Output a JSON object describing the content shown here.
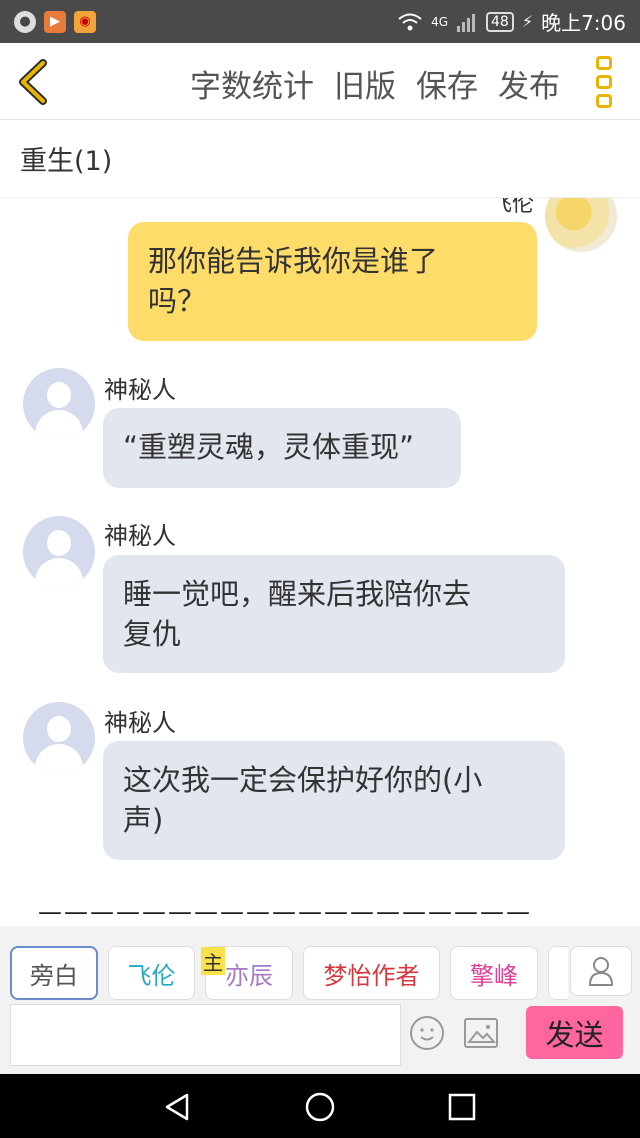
{
  "status_bar": {
    "network": "4G",
    "battery": "48",
    "time": "晚上7:06"
  },
  "toolbar": {
    "actions": [
      "字数统计",
      "旧版",
      "保存",
      "发布"
    ]
  },
  "chapter": {
    "title": "重生(1)"
  },
  "chat": {
    "self_name_partial": "飞伦",
    "messages": [
      {
        "sender": "",
        "text_line1": "那你能告诉我你是谁了",
        "text_line2": "吗？"
      },
      {
        "sender": "神秘人",
        "text_line1": "“重塑灵魂，灵体重现”",
        "text_line2": ""
      },
      {
        "sender": "神秘人",
        "text_line1": "睡一觉吧，醒来后我陪你去",
        "text_line2": "复仇"
      },
      {
        "sender": "神秘人",
        "text_line1": "这次我一定会保护好你的(小",
        "text_line2": "声)"
      }
    ],
    "separator": "———————————————————"
  },
  "roles": {
    "items": [
      {
        "label": "旁白",
        "color": "#555555"
      },
      {
        "label": "飞伦",
        "color": "#27a9c4"
      },
      {
        "label": "亦辰",
        "color": "#a678c6"
      },
      {
        "label": "梦怡作者",
        "color": "#d8383f"
      },
      {
        "label": "擎峰",
        "color": "#e03f9a"
      }
    ],
    "main_tag": "主"
  },
  "composer": {
    "input_value": "",
    "send_label": "发送"
  },
  "colors": {
    "accent": "#e8b400",
    "self_bubble": "#fedc6a",
    "other_bubble": "#e1e6ef",
    "send_button": "#ff66a0"
  }
}
